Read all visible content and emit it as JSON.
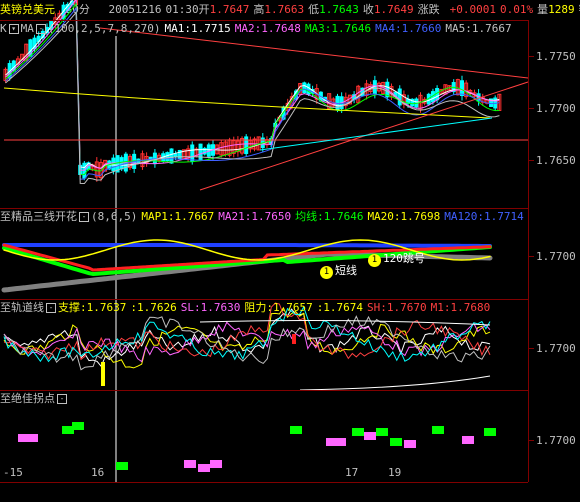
{
  "header": {
    "symbol": "英镑兑美元",
    "period": "30分",
    "date": "20051216",
    "time": "01:30",
    "open_label": "开",
    "open": "1.7647",
    "high_label": "高",
    "high": "1.7663",
    "low_label": "低",
    "low": "1.7643",
    "close_label": "收",
    "close": "1.7649",
    "change_label": "涨跌",
    "change": "+0.0001",
    "change_pct": "0.01%",
    "volume_label": "量",
    "volume": "1289",
    "amount_label": "额"
  },
  "main_panel": {
    "name": "K",
    "indicator": "MA",
    "params": "(100,2,5,7,8,270)",
    "items": [
      {
        "label": "MA1:",
        "value": "1.7715",
        "color": "#ffffff"
      },
      {
        "label": "MA2:",
        "value": "1.7648",
        "color": "#ff66ff"
      },
      {
        "label": "MA3:",
        "value": "1.7646",
        "color": "#00ff00"
      },
      {
        "label": "MA4:",
        "value": "1.7660",
        "color": "#4060ff"
      },
      {
        "label": "MA5:",
        "value": "1.7667",
        "color": "#c0c0c0"
      }
    ],
    "price_labels": [
      "1.7750",
      "1.7700",
      "1.7650"
    ]
  },
  "panel2": {
    "name": "至精品三线开花",
    "params": "(8,6,5)",
    "items": [
      {
        "label": "MAP1:",
        "value": "1.7667",
        "color": "#ffff00"
      },
      {
        "label": "MA21:",
        "value": "1.7650",
        "color": "#ff66ff"
      },
      {
        "label": "均线:",
        "value": "1.7646",
        "color": "#00ff00"
      },
      {
        "label": "MA20:",
        "value": "1.7698",
        "color": "#ffff00"
      },
      {
        "label": "MA120:",
        "value": "1.7714",
        "color": "#4060ff"
      }
    ],
    "price_label": "1.7700",
    "annotations": [
      {
        "badge": "1",
        "text": "短线"
      },
      {
        "badge": "1",
        "text": "120跳号"
      }
    ]
  },
  "panel3": {
    "name": "至轨道线",
    "items": [
      {
        "label": "支撑:",
        "value": "1.7637",
        "color": "#ffff00"
      },
      {
        "label": ":",
        "value": "1.7626",
        "color": "#ffff00"
      },
      {
        "label": "SL:",
        "value": "1.7630",
        "color": "#ff66ff"
      },
      {
        "label": "阻力:",
        "value": "1.7657",
        "color": "#ffff00"
      },
      {
        "label": ":",
        "value": "1.7674",
        "color": "#ffff00"
      },
      {
        "label": "SH:",
        "value": "1.7670",
        "color": "#ff4040"
      },
      {
        "label": "M1:",
        "value": "1.7680",
        "color": "#ff4040"
      }
    ],
    "price_label": "1.7700"
  },
  "panel4": {
    "name": "至绝佳拐点",
    "price_label": "1.7700"
  },
  "x_axis": {
    "labels": [
      "-15",
      "16",
      "17",
      "19"
    ]
  },
  "colors": {
    "up": "#ff3030",
    "down": "#00ffff",
    "frame": "#800000"
  }
}
